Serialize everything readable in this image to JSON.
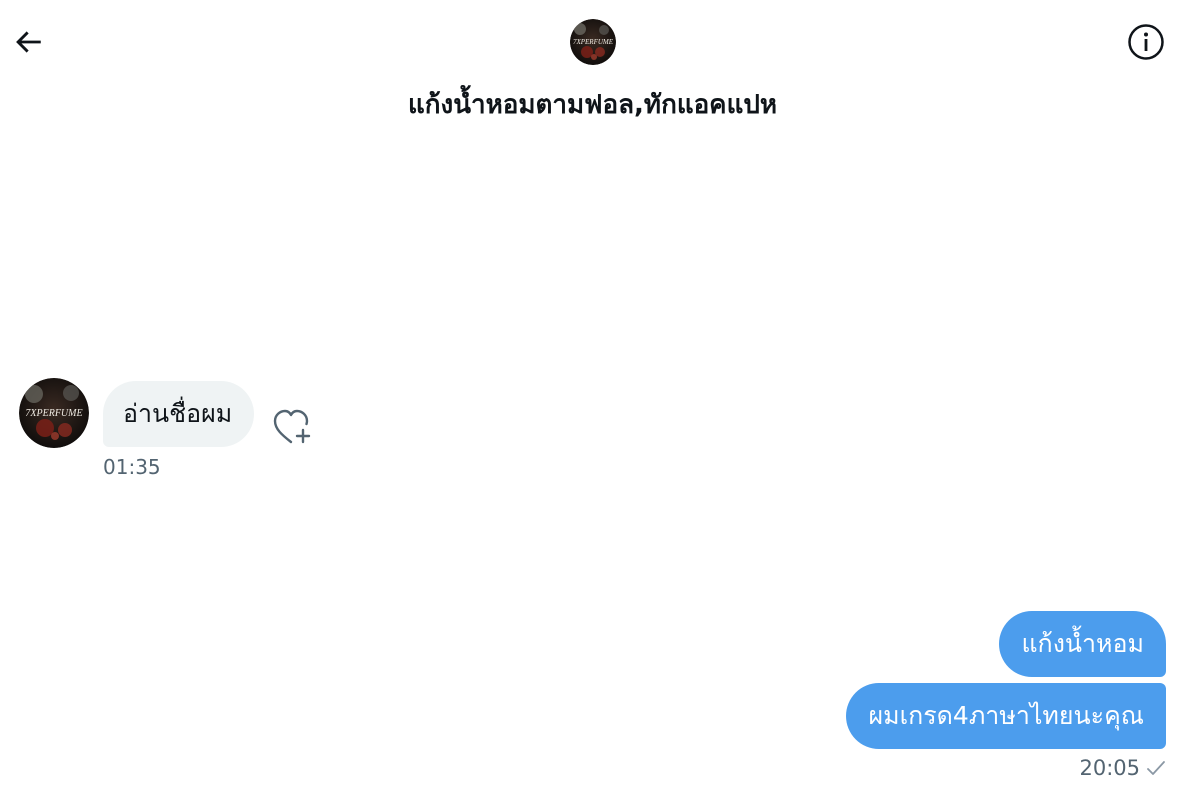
{
  "header": {
    "title": "แก้งน้ำหอมตามฟอล,ทักแอคแปห",
    "back_icon": "arrow-left-icon",
    "info_icon": "info-circle-icon",
    "avatar_text": "7XPERFUME"
  },
  "messages": {
    "incoming": [
      {
        "text": "อ่านชื่อผม",
        "time": "01:35",
        "avatar_text": "7XPERFUME"
      }
    ],
    "outgoing": [
      {
        "text": "แก้งน้ำหอม"
      },
      {
        "text": "ผมเกรด4ภาษาไทยนะคุณ"
      }
    ],
    "outgoing_time": "20:05",
    "status_icon": "checkmark-icon"
  },
  "colors": {
    "outgoing_bubble": "#4c9ded",
    "incoming_bubble": "#eff3f4",
    "meta_text": "#536471"
  }
}
